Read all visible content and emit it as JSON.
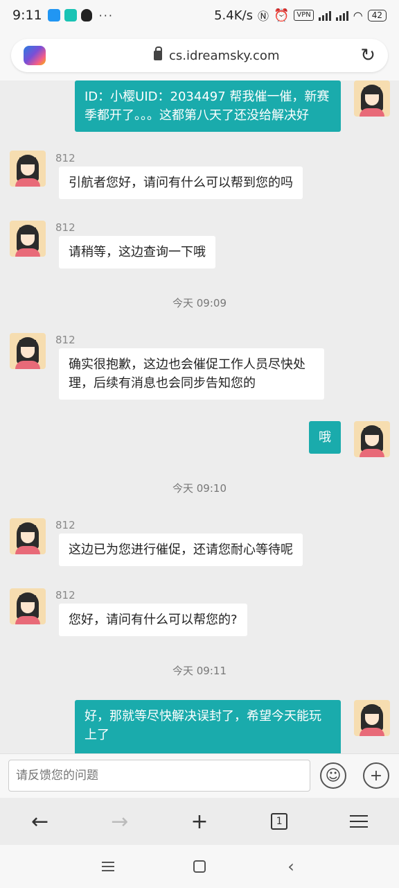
{
  "status_bar": {
    "time": "9:11",
    "dots": "···",
    "net_speed": "5.4K/s",
    "vpn": "VPN",
    "battery": "42"
  },
  "browser": {
    "url": "cs.idreamsky.com",
    "tab_count": "1"
  },
  "chat": {
    "agent_name": "812",
    "messages": [
      {
        "side": "out",
        "text": "ID：小樱UID：2034497 帮我催一催，新赛季都开了。。。这都第八天了还没给解决好"
      },
      {
        "side": "in",
        "text": "引航者您好，请问有什么可以帮到您的吗"
      },
      {
        "side": "in",
        "text": "请稍等，这边查询一下哦"
      },
      {
        "side": "in",
        "text": "确实很抱歉，这边也会催促工作人员尽快处理，后续有消息也会同步告知您的"
      },
      {
        "side": "out",
        "text": "哦"
      },
      {
        "side": "in",
        "text": "这边已为您进行催促，还请您耐心等待呢"
      },
      {
        "side": "in",
        "text": "您好，请问有什么可以帮您的?"
      },
      {
        "side": "out",
        "text": "好，那就等尽快解决误封了，希望今天能玩上了"
      }
    ],
    "time_separators": [
      "今天 09:09",
      "今天 09:10",
      "今天 09:11"
    ]
  },
  "input": {
    "placeholder": "请反馈您的问题"
  },
  "icons": {
    "emoji": "☺",
    "add": "+",
    "reload": "↻",
    "back": "←",
    "forward": "→",
    "new_tab": "+",
    "sys_back": "‹"
  },
  "colors": {
    "outgoing_bubble": "#1aabac",
    "incoming_bubble": "#ffffff",
    "background": "#ededed"
  }
}
